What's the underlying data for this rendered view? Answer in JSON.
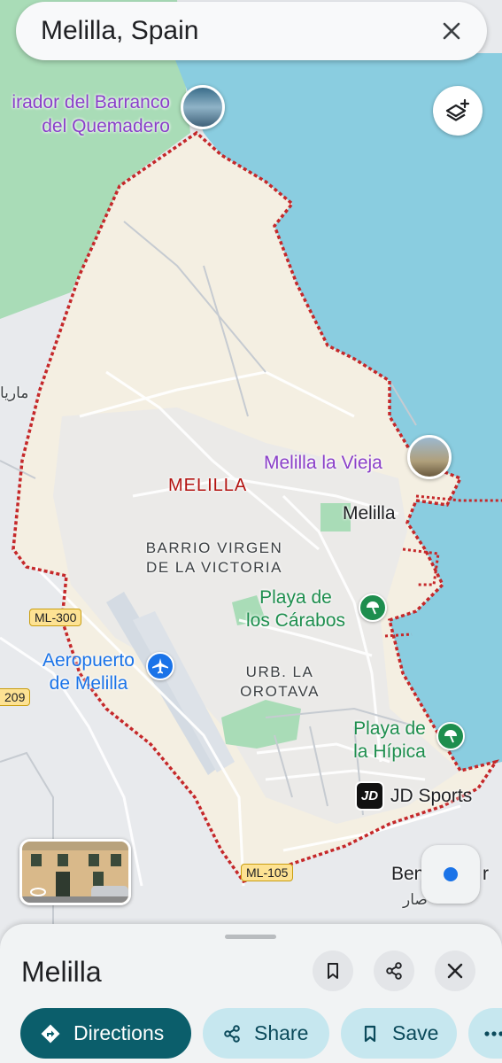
{
  "search": {
    "query": "Melilla, Spain"
  },
  "map": {
    "labels": {
      "mirador": [
        "irador del Barranco",
        "del Quemadero"
      ],
      "arabic_left": "ماريا",
      "vieja": "Melilla la Vieja",
      "city_upper": "MELILLA",
      "melilla_town": "Melilla",
      "barrio": [
        "BARRIO VIRGEN",
        "DE LA VICTORIA"
      ],
      "carabos": [
        "Playa de",
        "los Cárabos"
      ],
      "aeropuerto": [
        "Aeropuerto",
        "de Melilla"
      ],
      "urb": [
        "URB. LA",
        "OROTAVA"
      ],
      "hipica": [
        "Playa de",
        "la Hípica"
      ],
      "jd_sports": "JD Sports",
      "jd_logo": "JD",
      "beni": "Beni",
      "beni_end": "r",
      "arabic_bottom": "صار"
    },
    "road_shields": {
      "ml300": "ML-300",
      "ml105": "ML-105",
      "a209": "209"
    },
    "icons": {
      "layers": "layers-plus-icon",
      "airport": "airplane-icon",
      "beach": "beach-umbrella-icon",
      "close": "close-icon"
    },
    "colors": {
      "water": "#8acde0",
      "land": "#e8eaed",
      "inside": "#f4efe2",
      "park": "#8fd3a8",
      "boundary": "#c5282a",
      "beach_poi": "#1e8e4e",
      "airport_poi": "#1a73e8",
      "accent": "#0b5e6b"
    }
  },
  "sheet": {
    "title": "Melilla",
    "actions": [
      {
        "label": "Directions",
        "icon": "directions-icon"
      },
      {
        "label": "Share",
        "icon": "share-icon"
      },
      {
        "label": "Save",
        "icon": "bookmark-icon"
      },
      {
        "label": "",
        "icon": "more-icon"
      }
    ],
    "header_buttons": [
      "bookmark-icon",
      "share-icon",
      "close-icon"
    ]
  }
}
